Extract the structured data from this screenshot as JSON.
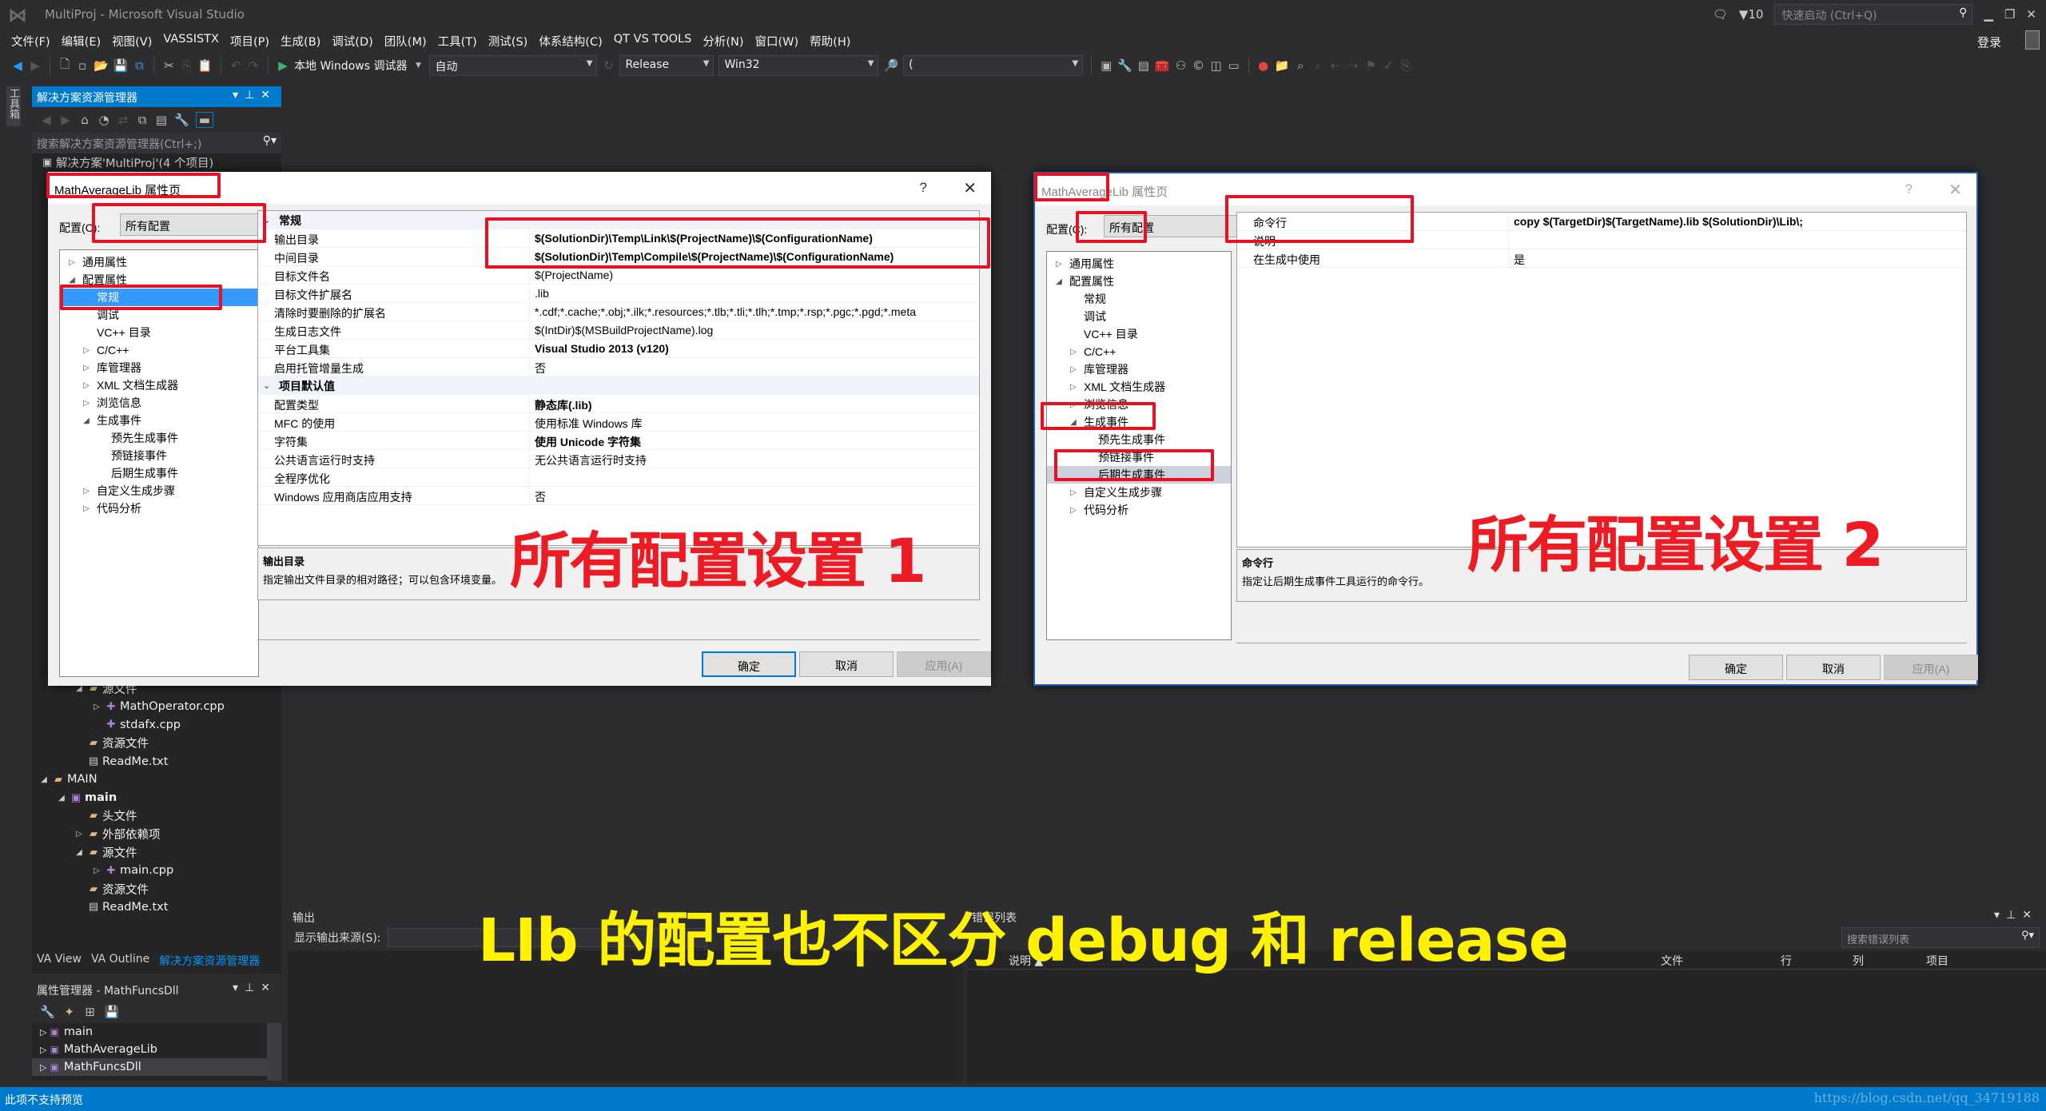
{
  "window": {
    "title": "MultiProj - Microsoft Visual Studio",
    "notifications_count": "10",
    "quick_launch_placeholder": "快速启动 (Ctrl+Q)",
    "login_label": "登录"
  },
  "menu": [
    "文件(F)",
    "编辑(E)",
    "视图(V)",
    "VASSISTX",
    "项目(P)",
    "生成(B)",
    "调试(D)",
    "团队(M)",
    "工具(T)",
    "测试(S)",
    "体系结构(C)",
    "QT VS TOOLS",
    "分析(N)",
    "窗口(W)",
    "帮助(H)"
  ],
  "toolbar": {
    "debugger_label": "本地 Windows 调试器",
    "solution_config_auto": "自动",
    "configuration": "Release",
    "platform": "Win32",
    "find_combo_value": "("
  },
  "toolbox_tab": "工具箱",
  "solution_explorer": {
    "title": "解决方案资源管理器",
    "search_placeholder": "搜索解决方案资源管理器(Ctrl+;)",
    "solution_label": "解决方案'MultiProj'(4 个项目)",
    "partial_row": "源文件",
    "items": [
      {
        "label": "MathOperator.cpp",
        "icon": "cpp-file",
        "expand": "▷",
        "indent": 3
      },
      {
        "label": "stdafx.cpp",
        "icon": "cpp-file",
        "expand": "",
        "indent": 3
      },
      {
        "label": "资源文件",
        "icon": "folder",
        "expand": "",
        "indent": 2
      },
      {
        "label": "ReadMe.txt",
        "icon": "document",
        "expand": "",
        "indent": 2
      },
      {
        "label": "MAIN",
        "icon": "folder",
        "expand": "◢",
        "indent": 0
      },
      {
        "label": "main",
        "icon": "project",
        "expand": "◢",
        "indent": 1,
        "bold": true
      },
      {
        "label": "头文件",
        "icon": "folder",
        "expand": "",
        "indent": 2
      },
      {
        "label": "外部依赖项",
        "icon": "folder",
        "expand": "▷",
        "indent": 2
      },
      {
        "label": "源文件",
        "icon": "folder",
        "expand": "◢",
        "indent": 2
      },
      {
        "label": "main.cpp",
        "icon": "cpp-file",
        "expand": "▷",
        "indent": 3
      },
      {
        "label": "资源文件",
        "icon": "folder",
        "expand": "",
        "indent": 2
      },
      {
        "label": "ReadMe.txt",
        "icon": "document",
        "expand": "",
        "indent": 2
      }
    ]
  },
  "bottom_tabs": [
    "VA View",
    "VA Outline",
    "解决方案资源管理器"
  ],
  "property_manager": {
    "title": "属性管理器 - MathFuncsDll",
    "items": [
      "main",
      "MathAverageLib",
      "MathFuncsDll"
    ],
    "selected": "MathFuncsDll"
  },
  "dialog1": {
    "title": "MathAverageLib 属性页",
    "help": "?",
    "close": "✕",
    "config_label": "配置(C):",
    "config_value": "所有配置",
    "nav": [
      {
        "label": "通用属性",
        "expand": "▷",
        "level": 0
      },
      {
        "label": "配置属性",
        "expand": "◢",
        "level": 0
      },
      {
        "label": "常规",
        "expand": "",
        "level": 1,
        "selected": true
      },
      {
        "label": "调试",
        "expand": "",
        "level": 1
      },
      {
        "label": "VC++ 目录",
        "expand": "",
        "level": 1
      },
      {
        "label": "C/C++",
        "expand": "▷",
        "level": 1
      },
      {
        "label": "库管理器",
        "expand": "▷",
        "level": 1
      },
      {
        "label": "XML 文档生成器",
        "expand": "▷",
        "level": 1
      },
      {
        "label": "浏览信息",
        "expand": "▷",
        "level": 1
      },
      {
        "label": "生成事件",
        "expand": "◢",
        "level": 1
      },
      {
        "label": "预先生成事件",
        "expand": "",
        "level": 2
      },
      {
        "label": "预链接事件",
        "expand": "",
        "level": 2
      },
      {
        "label": "后期生成事件",
        "expand": "",
        "level": 2
      },
      {
        "label": "自定义生成步骤",
        "expand": "▷",
        "level": 1
      },
      {
        "label": "代码分析",
        "expand": "▷",
        "level": 1
      }
    ],
    "categories": [
      {
        "name": "常规",
        "rows": [
          {
            "key": "输出目录",
            "value": "$(SolutionDir)\\Temp\\Link\\$(ProjectName)\\$(ConfigurationName)",
            "bold": true
          },
          {
            "key": "中间目录",
            "value": "$(SolutionDir)\\Temp\\Compile\\$(ProjectName)\\$(ConfigurationName)",
            "bold": true
          },
          {
            "key": "目标文件名",
            "value": "$(ProjectName)"
          },
          {
            "key": "目标文件扩展名",
            "value": ".lib"
          },
          {
            "key": "清除时要删除的扩展名",
            "value": "*.cdf;*.cache;*.obj;*.ilk;*.resources;*.tlb;*.tli;*.tlh;*.tmp;*.rsp;*.pgc;*.pgd;*.meta"
          },
          {
            "key": "生成日志文件",
            "value": "$(IntDir)$(MSBuildProjectName).log"
          },
          {
            "key": "平台工具集",
            "value": "Visual Studio 2013 (v120)",
            "bold": true
          },
          {
            "key": "启用托管增量生成",
            "value": "否"
          }
        ]
      },
      {
        "name": "项目默认值",
        "rows": [
          {
            "key": "配置类型",
            "value": "静态库(.lib)",
            "bold": true
          },
          {
            "key": "MFC 的使用",
            "value": "使用标准 Windows 库"
          },
          {
            "key": "字符集",
            "value": "使用 Unicode 字符集",
            "bold": true
          },
          {
            "key": "公共语言运行时支持",
            "value": "无公共语言运行时支持"
          },
          {
            "key": "全程序优化",
            "value": ""
          },
          {
            "key": "Windows 应用商店应用支持",
            "value": "否"
          }
        ]
      }
    ],
    "desc_title": "输出目录",
    "desc_text": "指定输出文件目录的相对路径；可以包含环境变量。",
    "ok": "确定",
    "cancel": "取消",
    "apply": "应用(A)",
    "annotation": "所有配置设置 1"
  },
  "dialog2": {
    "title": "MathAverageLib 属性页",
    "help": "?",
    "close": "✕",
    "config_label": "配置(C):",
    "config_value": "所有配置",
    "nav": [
      {
        "label": "通用属性",
        "expand": "▷",
        "level": 0
      },
      {
        "label": "配置属性",
        "expand": "◢",
        "level": 0
      },
      {
        "label": "常规",
        "expand": "",
        "level": 1
      },
      {
        "label": "调试",
        "expand": "",
        "level": 1
      },
      {
        "label": "VC++ 目录",
        "expand": "",
        "level": 1
      },
      {
        "label": "C/C++",
        "expand": "▷",
        "level": 1
      },
      {
        "label": "库管理器",
        "expand": "▷",
        "level": 1
      },
      {
        "label": "XML 文档生成器",
        "expand": "▷",
        "level": 1
      },
      {
        "label": "浏览信息",
        "expand": "▷",
        "level": 1
      },
      {
        "label": "生成事件",
        "expand": "◢",
        "level": 1
      },
      {
        "label": "预先生成事件",
        "expand": "",
        "level": 2
      },
      {
        "label": "预链接事件",
        "expand": "",
        "level": 2
      },
      {
        "label": "后期生成事件",
        "expand": "",
        "level": 2,
        "selected": true
      },
      {
        "label": "自定义生成步骤",
        "expand": "▷",
        "level": 1
      },
      {
        "label": "代码分析",
        "expand": "▷",
        "level": 1
      }
    ],
    "rows": [
      {
        "key": "命令行",
        "value": "copy $(TargetDir)$(TargetName).lib $(SolutionDir)\\Lib\\;",
        "bold": true
      },
      {
        "key": "说明",
        "value": ""
      },
      {
        "key": "在生成中使用",
        "value": "是"
      }
    ],
    "desc_title": "命令行",
    "desc_text": "指定让后期生成事件工具运行的命令行。",
    "ok": "确定",
    "cancel": "取消",
    "apply": "应用(A)",
    "annotation": "所有配置设置 2"
  },
  "output_panel": {
    "title": "输出",
    "source_label": "显示输出来源(S):"
  },
  "error_list": {
    "title": "错误列表",
    "search_placeholder": "搜索错误列表",
    "columns": [
      "说明 ▲",
      "文件",
      "行",
      "列",
      "项目"
    ]
  },
  "annotation_bottom": "LIb 的配置也不区分 debug 和 release",
  "statusbar": {
    "text": "此项不支持预览",
    "watermark": "https://blog.csdn.net/qq_34719188"
  }
}
